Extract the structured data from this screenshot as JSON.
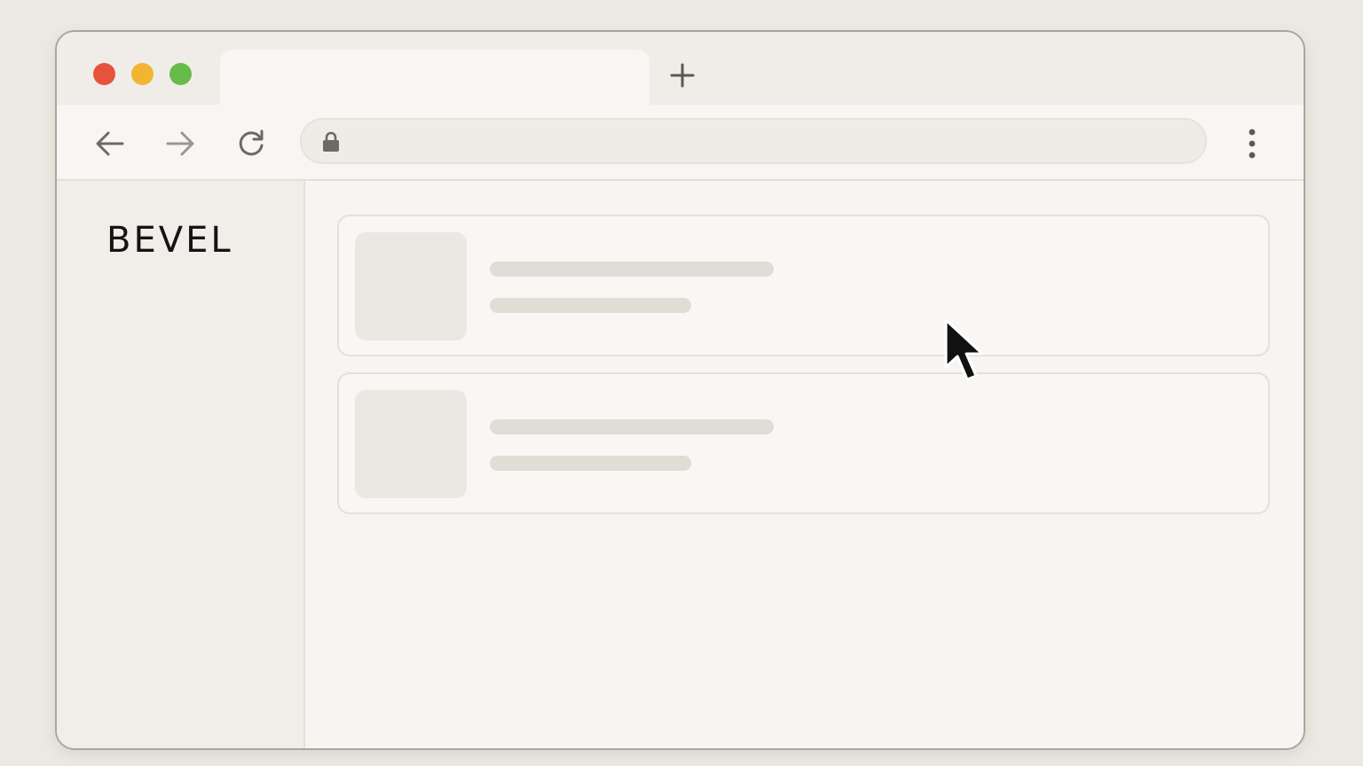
{
  "app": {
    "logo_text": "BEVEL"
  },
  "window_controls": {
    "close_color": "#e5533c",
    "minimize_color": "#f2b531",
    "maximize_color": "#67bb4a"
  },
  "tabs": [
    {
      "label": "",
      "active": true
    }
  ],
  "toolbar": {
    "icons": [
      "arrow-left-icon",
      "arrow-right-icon",
      "reload-icon",
      "lock-icon",
      "kebab-menu-icon"
    ],
    "address": ""
  },
  "main": {
    "cards": [
      {
        "state": "loading-placeholder"
      },
      {
        "state": "loading-placeholder"
      }
    ]
  },
  "colors": {
    "background": "#ece9e2",
    "window": "#f6f4f0",
    "placeholder": "#e0ddd7"
  }
}
